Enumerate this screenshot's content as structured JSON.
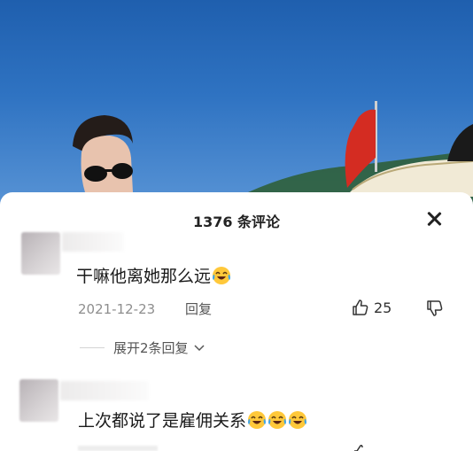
{
  "header": {
    "title": "1376 条评论",
    "close_icon": "close-icon"
  },
  "comments": [
    {
      "text": "干嘛他离她那么远",
      "emoji": "laughing-tears-emoji",
      "emoji_count": 1,
      "date": "2021-12-23",
      "reply_label": "回复",
      "likes": "25",
      "expand_label": "展开2条回复"
    },
    {
      "text": "上次都说了是雇佣关系",
      "emoji": "laughing-tears-emoji",
      "emoji_count": 3
    }
  ],
  "icons": {
    "like": "thumbs-up-icon",
    "dislike": "thumbs-down-icon",
    "expand": "chevron-down-icon"
  },
  "colors": {
    "sky": "#2f73c2",
    "flag": "#d42c22",
    "emoji_face": "#ffc83a",
    "tears": "#3fa4ea"
  }
}
